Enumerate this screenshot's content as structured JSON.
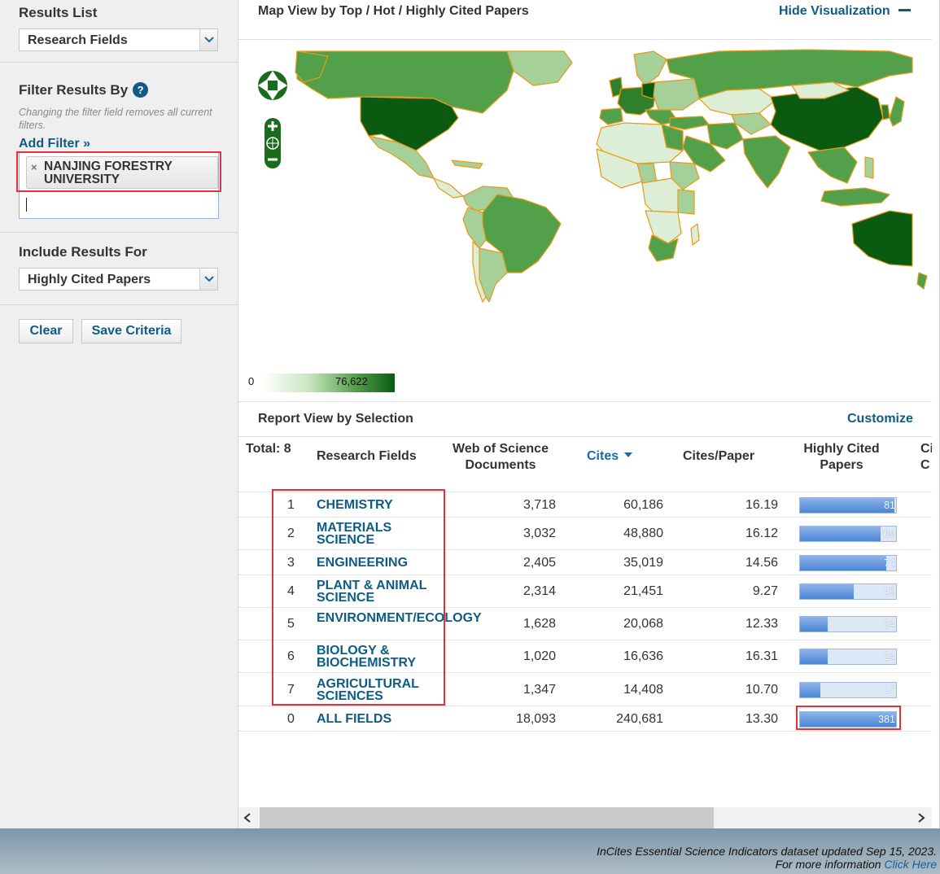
{
  "sidebar": {
    "results_list": {
      "heading": "Results List",
      "value": "Research Fields"
    },
    "filter": {
      "heading": "Filter Results By",
      "help": "?",
      "note": "Changing the filter field removes all current filters.",
      "add_filter": "Add Filter »",
      "chip_remove": "×",
      "chip": "NANJING FORESTRY UNIVERSITY",
      "input_value": ""
    },
    "include": {
      "heading": "Include Results For",
      "value": "Highly Cited Papers"
    },
    "buttons": {
      "clear": "Clear",
      "save": "Save Criteria"
    }
  },
  "map": {
    "title": "Map View by Top / Hot / Highly Cited Papers",
    "hide_link": "Hide Visualization",
    "legend_min": "0",
    "legend_max": "76,622",
    "colors": {
      "darkest": "#0b5a12",
      "dark": "#2f7f2c",
      "mid": "#53a04a",
      "light": "#a6d09a",
      "pale": "#dcefd6",
      "border": "#e89a18"
    }
  },
  "report": {
    "title": "Report View by Selection",
    "customize": "Customize",
    "columns": {
      "total": "Total: 8",
      "field": "Research Fields",
      "docs": "Web of Science Documents",
      "cites": "Cites",
      "cites_per_paper": "Cites/Paper",
      "hcp": "Highly Cited Papers",
      "cut": "Ci C"
    },
    "rows": [
      {
        "rank": "1",
        "field": "CHEMISTRY",
        "docs": "3,718",
        "cites": "60,186",
        "cpp": "16.19",
        "hcp": "81",
        "hcp_fraction": 0.98
      },
      {
        "rank": "2",
        "field": "MATERIALS SCIENCE",
        "docs": "3,032",
        "cites": "48,880",
        "cpp": "16.12",
        "hcp": "69",
        "hcp_fraction": 0.84
      },
      {
        "rank": "3",
        "field": "ENGINEERING",
        "docs": "2,405",
        "cites": "35,019",
        "cpp": "14.56",
        "hcp": "74",
        "hcp_fraction": 0.9
      },
      {
        "rank": "4",
        "field": "PLANT & ANIMAL SCIENCE",
        "docs": "2,314",
        "cites": "21,451",
        "cpp": "9.27",
        "hcp": "46",
        "hcp_fraction": 0.56
      },
      {
        "rank": "5",
        "field": "ENVIRONMENT/ECOLOGY",
        "docs": "1,628",
        "cites": "20,068",
        "cpp": "12.33",
        "hcp": "24",
        "hcp_fraction": 0.29
      },
      {
        "rank": "6",
        "field": "BIOLOGY & BIOCHEMISTRY",
        "docs": "1,020",
        "cites": "16,636",
        "cpp": "16.31",
        "hcp": "24",
        "hcp_fraction": 0.29
      },
      {
        "rank": "7",
        "field": "AGRICULTURAL SCIENCES",
        "docs": "1,347",
        "cites": "14,408",
        "cpp": "10.70",
        "hcp": "17",
        "hcp_fraction": 0.21
      }
    ],
    "total_row": {
      "rank": "0",
      "field": "ALL FIELDS",
      "docs": "18,093",
      "cites": "240,681",
      "cpp": "13.30",
      "hcp": "381",
      "hcp_fraction": 1.0
    }
  },
  "footer": {
    "line1": "InCites Essential Science Indicators dataset updated Sep 15, 2023.",
    "line2": "For more information",
    "link": "Click Here"
  }
}
